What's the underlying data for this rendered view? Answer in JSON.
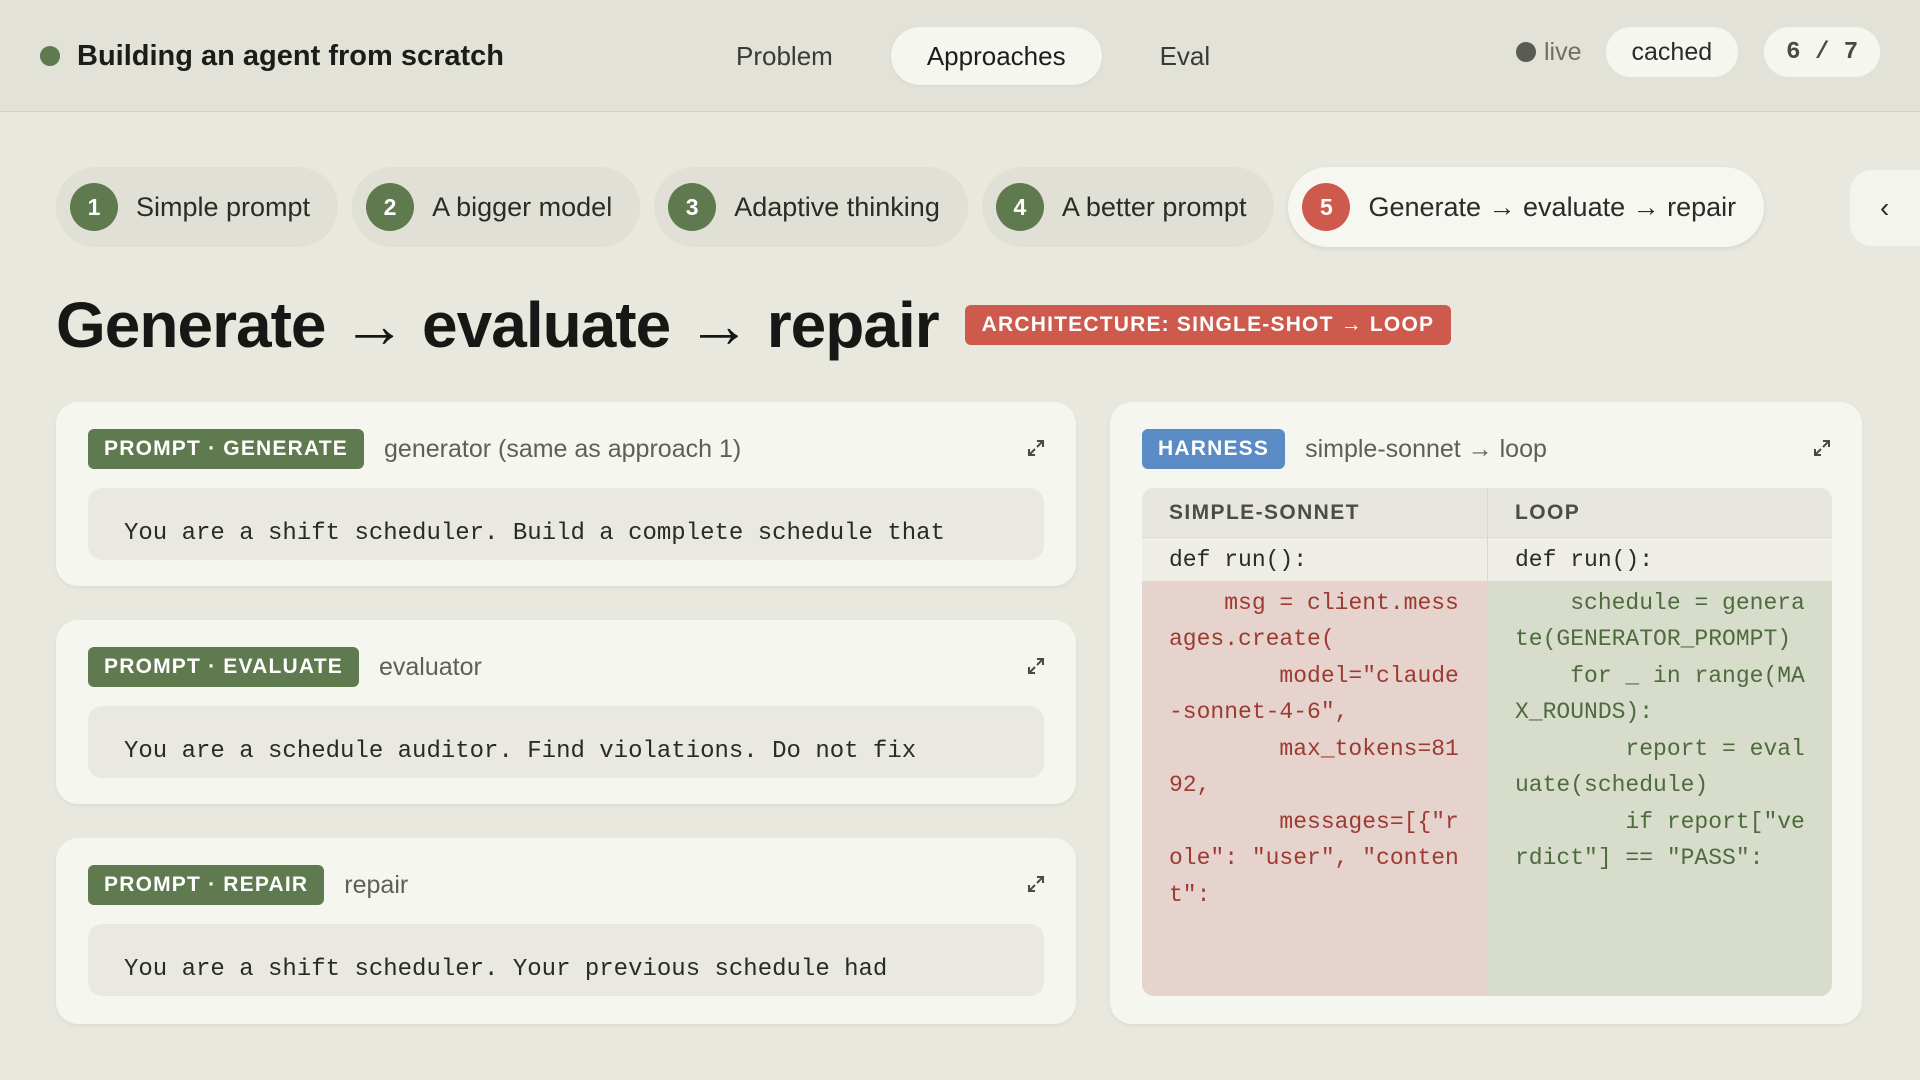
{
  "header": {
    "title": "Building an agent from scratch",
    "tabs": [
      {
        "label": "Problem"
      },
      {
        "label": "Approaches"
      },
      {
        "label": "Eval"
      }
    ],
    "live_label": "live",
    "cached_label": "cached",
    "counter": "6 / 7"
  },
  "steps": [
    {
      "num": "1",
      "label": "Simple prompt"
    },
    {
      "num": "2",
      "label": "A bigger model"
    },
    {
      "num": "3",
      "label": "Adaptive thinking"
    },
    {
      "num": "4",
      "label": "A better prompt"
    },
    {
      "num": "5",
      "label": "Generate → evaluate → repair"
    }
  ],
  "collapse_icon": "chevron-left-icon",
  "page": {
    "title": "Generate → evaluate → repair",
    "badge": "ARCHITECTURE: SINGLE-SHOT → LOOP"
  },
  "prompts": [
    {
      "tag": "PROMPT · GENERATE",
      "subtitle": "generator (same as approach 1)",
      "text": "You are a shift scheduler. Build a complete schedule that"
    },
    {
      "tag": "PROMPT · EVALUATE",
      "subtitle": "evaluator",
      "text": "You are a schedule auditor. Find violations. Do not fix"
    },
    {
      "tag": "PROMPT · REPAIR",
      "subtitle": "repair",
      "text": "You are a shift scheduler. Your previous schedule had"
    }
  ],
  "harness": {
    "tag": "HARNESS",
    "subtitle": "simple-sonnet → loop",
    "left": {
      "header": "SIMPLE-SONNET",
      "context": "def run():",
      "removed": "    msg = client.messages.create(\n        model=\"claude-sonnet-4-6\",\n        max_tokens=8192,\n        messages=[{\"role\": \"user\", \"content\":"
    },
    "right": {
      "header": "LOOP",
      "context": "def run():",
      "added": "    schedule = generate(GENERATOR_PROMPT)\n    for _ in range(MAX_ROUNDS):\n        report = evaluate(schedule)\n        if report[\"verdict\"] == \"PASS\":"
    }
  },
  "colors": {
    "accent_green": "#5e7a4e",
    "accent_red": "#cd5a4c",
    "accent_blue": "#5b8bc4"
  }
}
